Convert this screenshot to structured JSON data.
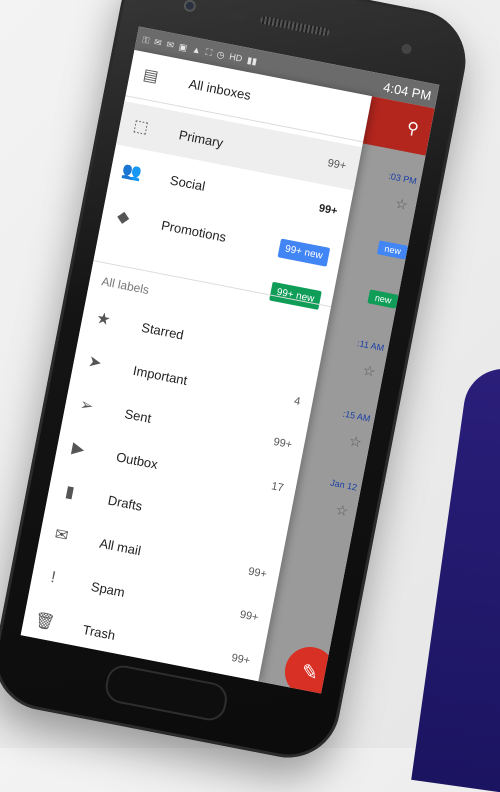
{
  "status": {
    "time": "4:04 PM",
    "icons": [
      "⚿",
      "✉",
      "✉",
      "▣",
      "▲",
      "⛶",
      "◷",
      "HD",
      "▮▮"
    ]
  },
  "drawer": {
    "header": {
      "label": "All inboxes"
    },
    "inbox_items": [
      {
        "label": "Primary",
        "count": "99+",
        "icon": "inbox-icon",
        "glyph": "⬚",
        "selected": true
      },
      {
        "label": "Social",
        "count": "99+",
        "icon": "people-icon",
        "glyph": "👥",
        "bold": true
      },
      {
        "label": "Promotions",
        "chip": "99+ new",
        "chip_color": "#4285f4",
        "icon": "tag-icon",
        "glyph": "◆"
      }
    ],
    "updates_chip": "99+ new",
    "section_label": "All labels",
    "label_items": [
      {
        "label": "Starred",
        "count": "",
        "icon": "star-icon",
        "glyph": "★"
      },
      {
        "label": "Important",
        "count": "4",
        "icon": "important-icon",
        "glyph": "➤"
      },
      {
        "label": "Sent",
        "count": "99+",
        "icon": "send-icon",
        "glyph": "➢"
      },
      {
        "label": "Outbox",
        "count": "17",
        "icon": "outbox-icon",
        "glyph": "▶"
      },
      {
        "label": "Drafts",
        "count": "",
        "icon": "draft-icon",
        "glyph": "▮"
      },
      {
        "label": "All mail",
        "count": "99+",
        "icon": "mail-icon",
        "glyph": "✉"
      },
      {
        "label": "Spam",
        "count": "99+",
        "icon": "spam-icon",
        "glyph": "!"
      },
      {
        "label": "Trash",
        "count": "99+",
        "icon": "trash-icon",
        "glyph": "🗑"
      }
    ]
  },
  "background_app": {
    "search_icon": "search-icon",
    "items": [
      {
        "text": ":03 PM"
      },
      {
        "chip": "new",
        "color": "#4285f4"
      },
      {
        "chip": "new",
        "color": "#0f9d58"
      },
      {
        "text": ":11 AM"
      },
      {
        "text": ":15 AM"
      },
      {
        "text": "Jan 12"
      }
    ]
  },
  "colors": {
    "accent_red": "#b3261e",
    "chip_blue": "#4285f4",
    "chip_green": "#0f9d58"
  }
}
